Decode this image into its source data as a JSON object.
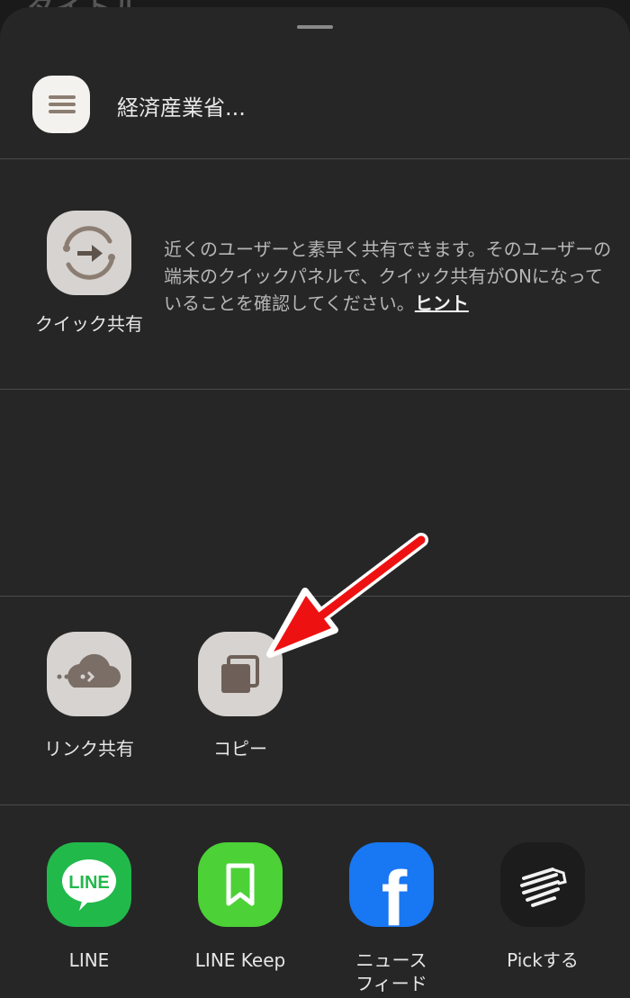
{
  "background_title": "タイトル",
  "header": {
    "title": "経済産業省..."
  },
  "quick_share": {
    "label": "クイック共有",
    "description": "近くのユーザーと素早く共有できます。そのユーザーの端末のクイックパネルで、クイック共有がONになっていることを確認してください。",
    "hint_link": "ヒント"
  },
  "actions": [
    {
      "label": "リンク共有",
      "icon": "cloud-link-icon"
    },
    {
      "label": "コピー",
      "icon": "copy-icon"
    }
  ],
  "apps": [
    {
      "label": "LINE",
      "icon": "line-icon",
      "icon_text": "LINE"
    },
    {
      "label": "LINE Keep",
      "icon": "bookmark-icon"
    },
    {
      "label": "ニュース\nフィード",
      "icon": "facebook-icon",
      "icon_text": "f"
    },
    {
      "label": "Pickする",
      "icon": "zebra-icon"
    }
  ],
  "colors": {
    "sheet_bg": "#262626",
    "line_green": "#22b94b",
    "keep_green": "#4cd137",
    "facebook_blue": "#1877f2",
    "annotation_arrow": "#ee1111"
  }
}
